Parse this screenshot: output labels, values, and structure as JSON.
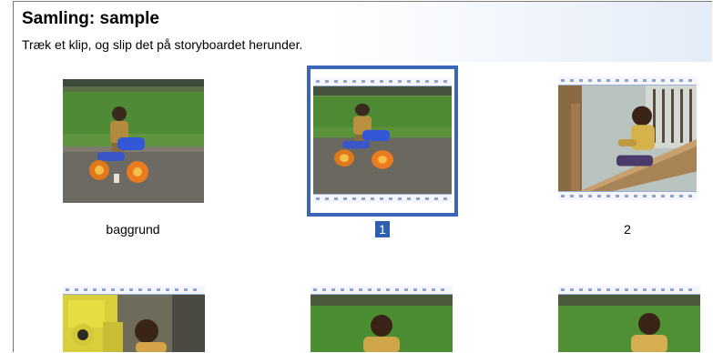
{
  "collection": {
    "title": "Samling: sample",
    "instruction": "Træk et klip, og slip det på storyboardet herunder."
  },
  "clips": [
    {
      "caption": "baggrund",
      "selected": false,
      "scene": "toddler-on-tricycle-icon"
    },
    {
      "caption": "1",
      "selected": true,
      "scene": "toddler-on-tricycle-icon"
    },
    {
      "caption": "2",
      "selected": false,
      "scene": "child-on-slide-icon"
    },
    {
      "caption": "",
      "selected": false,
      "scene": "child-with-toy-blocks-icon"
    },
    {
      "caption": "",
      "selected": false,
      "scene": "child-on-lawn-icon"
    },
    {
      "caption": "",
      "selected": false,
      "scene": "child-on-lawn-icon"
    }
  ],
  "colors": {
    "selection": "#3b66b8",
    "selected_caption_bg": "#2f5fb0",
    "header_gradient_end": "#e4ecf8"
  }
}
